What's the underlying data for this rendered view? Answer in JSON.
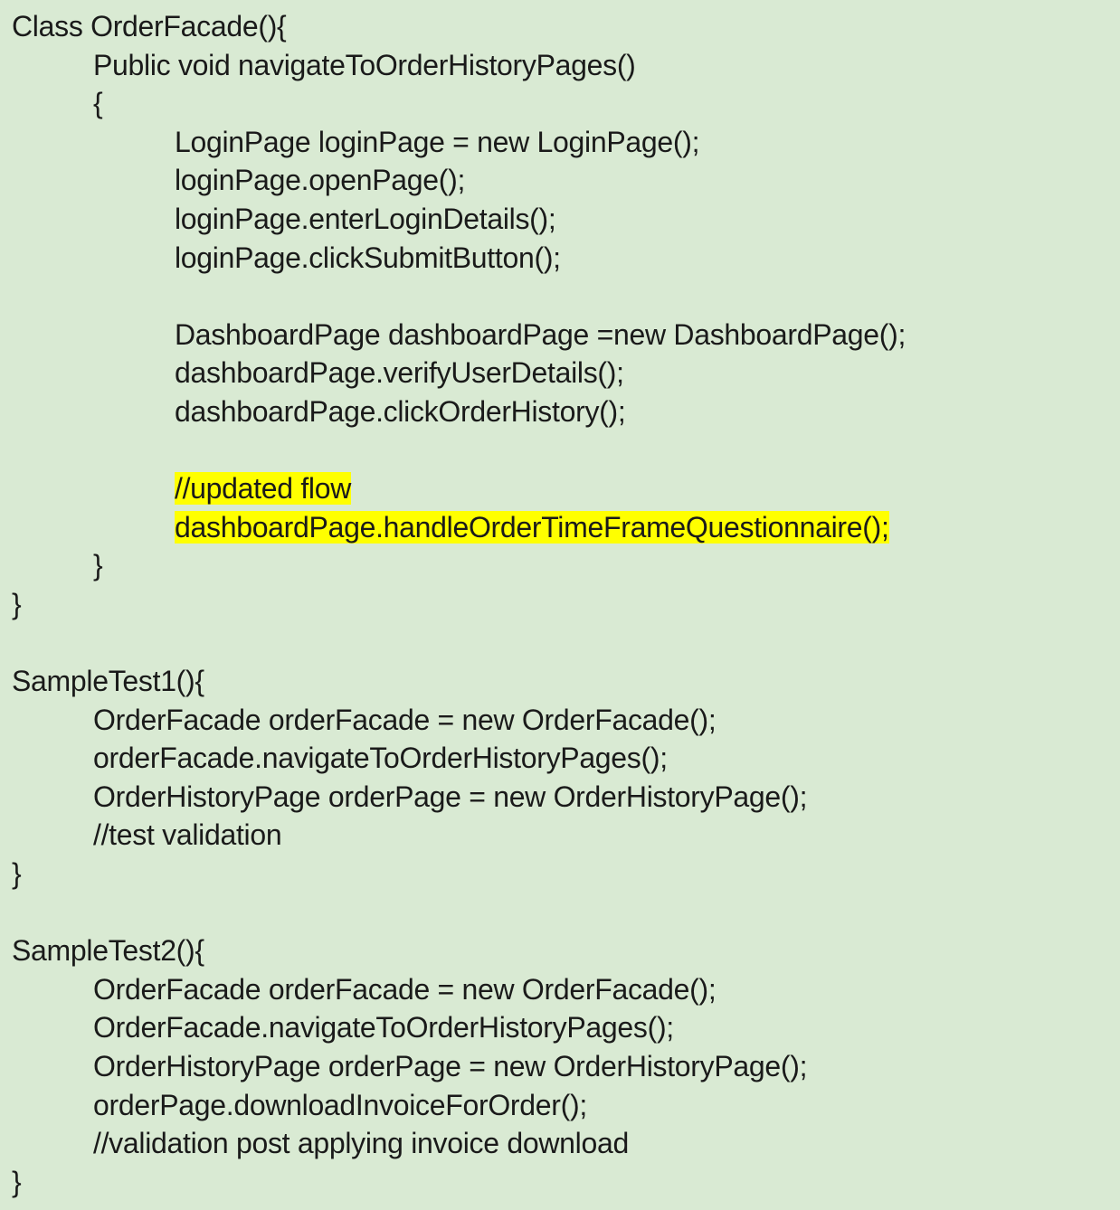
{
  "lines": [
    {
      "text": "Class OrderFacade(){",
      "indent": 0,
      "highlight": false
    },
    {
      "text": "Public void navigateToOrderHistoryPages()",
      "indent": 1,
      "highlight": false
    },
    {
      "text": "{",
      "indent": 1,
      "highlight": false
    },
    {
      "text": "LoginPage loginPage = new LoginPage();",
      "indent": 2,
      "highlight": false
    },
    {
      "text": "loginPage.openPage();",
      "indent": 2,
      "highlight": false
    },
    {
      "text": "loginPage.enterLoginDetails();",
      "indent": 2,
      "highlight": false
    },
    {
      "text": "loginPage.clickSubmitButton();",
      "indent": 2,
      "highlight": false
    },
    {
      "text": "",
      "indent": 0,
      "highlight": false
    },
    {
      "text": "DashboardPage dashboardPage =new DashboardPage();",
      "indent": 2,
      "highlight": false
    },
    {
      "text": "dashboardPage.verifyUserDetails();",
      "indent": 2,
      "highlight": false
    },
    {
      "text": "dashboardPage.clickOrderHistory();",
      "indent": 2,
      "highlight": false
    },
    {
      "text": "",
      "indent": 0,
      "highlight": false
    },
    {
      "text": "//updated flow",
      "indent": 2,
      "highlight": true
    },
    {
      "text": "dashboardPage.handleOrderTimeFrameQuestionnaire();",
      "indent": 2,
      "highlight": true
    },
    {
      "text": "}",
      "indent": 1,
      "highlight": false
    },
    {
      "text": "}",
      "indent": 0,
      "highlight": false
    },
    {
      "text": "",
      "indent": 0,
      "highlight": false
    },
    {
      "text": "SampleTest1(){",
      "indent": 0,
      "highlight": false
    },
    {
      "text": "OrderFacade orderFacade = new OrderFacade();",
      "indent": 1,
      "highlight": false
    },
    {
      "text": "orderFacade.navigateToOrderHistoryPages();",
      "indent": 1,
      "highlight": false
    },
    {
      "text": "OrderHistoryPage orderPage = new OrderHistoryPage();",
      "indent": 1,
      "highlight": false
    },
    {
      "text": "//test validation",
      "indent": 1,
      "highlight": false
    },
    {
      "text": "}",
      "indent": 0,
      "highlight": false
    },
    {
      "text": "",
      "indent": 0,
      "highlight": false
    },
    {
      "text": "SampleTest2(){",
      "indent": 0,
      "highlight": false
    },
    {
      "text": "OrderFacade orderFacade = new OrderFacade();",
      "indent": 1,
      "highlight": false
    },
    {
      "text": "OrderFacade.navigateToOrderHistoryPages();",
      "indent": 1,
      "highlight": false
    },
    {
      "text": "OrderHistoryPage orderPage = new OrderHistoryPage();",
      "indent": 1,
      "highlight": false
    },
    {
      "text": "orderPage.downloadInvoiceForOrder();",
      "indent": 1,
      "highlight": false
    },
    {
      "text": "//validation post applying invoice download",
      "indent": 1,
      "highlight": false
    },
    {
      "text": "}",
      "indent": 0,
      "highlight": false
    }
  ],
  "colors": {
    "background": "#d9ead3",
    "highlight": "#ffff00",
    "text": "#1a1a1a"
  }
}
